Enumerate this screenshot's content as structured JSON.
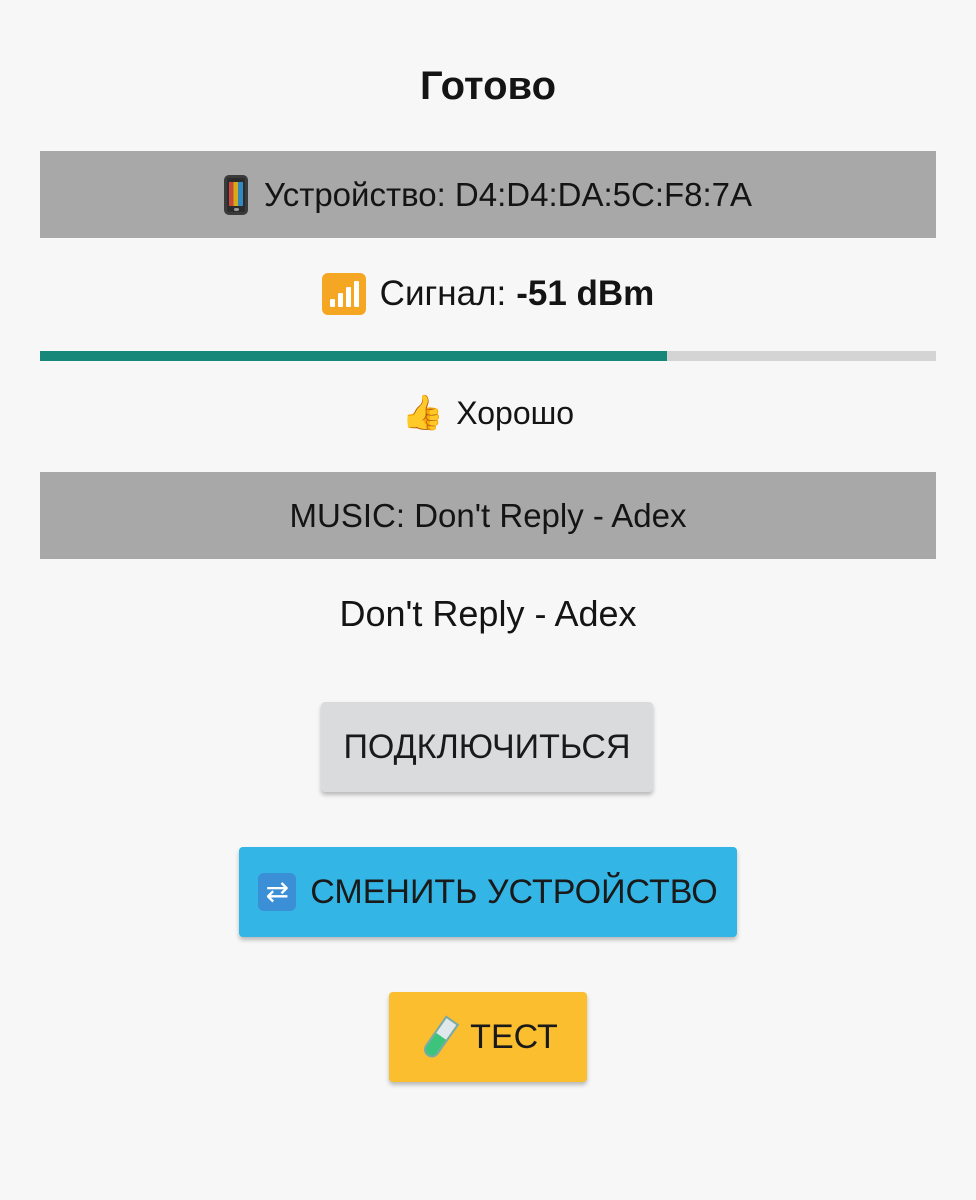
{
  "status": {
    "title": "Готово"
  },
  "device": {
    "icon": "mobile-phone-icon",
    "text": "Устройство: D4:D4:DA:5C:F8:7A"
  },
  "signal": {
    "icon": "antenna-bars-icon",
    "label": "Сигнал:",
    "value": "-51 dBm",
    "strength_fraction": 0.7,
    "bar_fill_color": "#17877a",
    "bar_track_color": "#d4d4d4"
  },
  "quality": {
    "icon": "thumbs-up-icon",
    "text": "Хорошо"
  },
  "music": {
    "header": "MUSIC: Don't Reply - Adex",
    "track": "Don't Reply - Adex"
  },
  "buttons": {
    "connect_label": "ПОДКЛЮЧИТЬСЯ",
    "switch_icon": "swap-arrows-icon",
    "switch_label": "СМЕНИТЬ УСТРОЙСТВО",
    "switch_color": "#33b5e5",
    "test_icon": "test-tube-icon",
    "test_label": "ТЕСТ",
    "test_color": "#fbbe2e"
  }
}
